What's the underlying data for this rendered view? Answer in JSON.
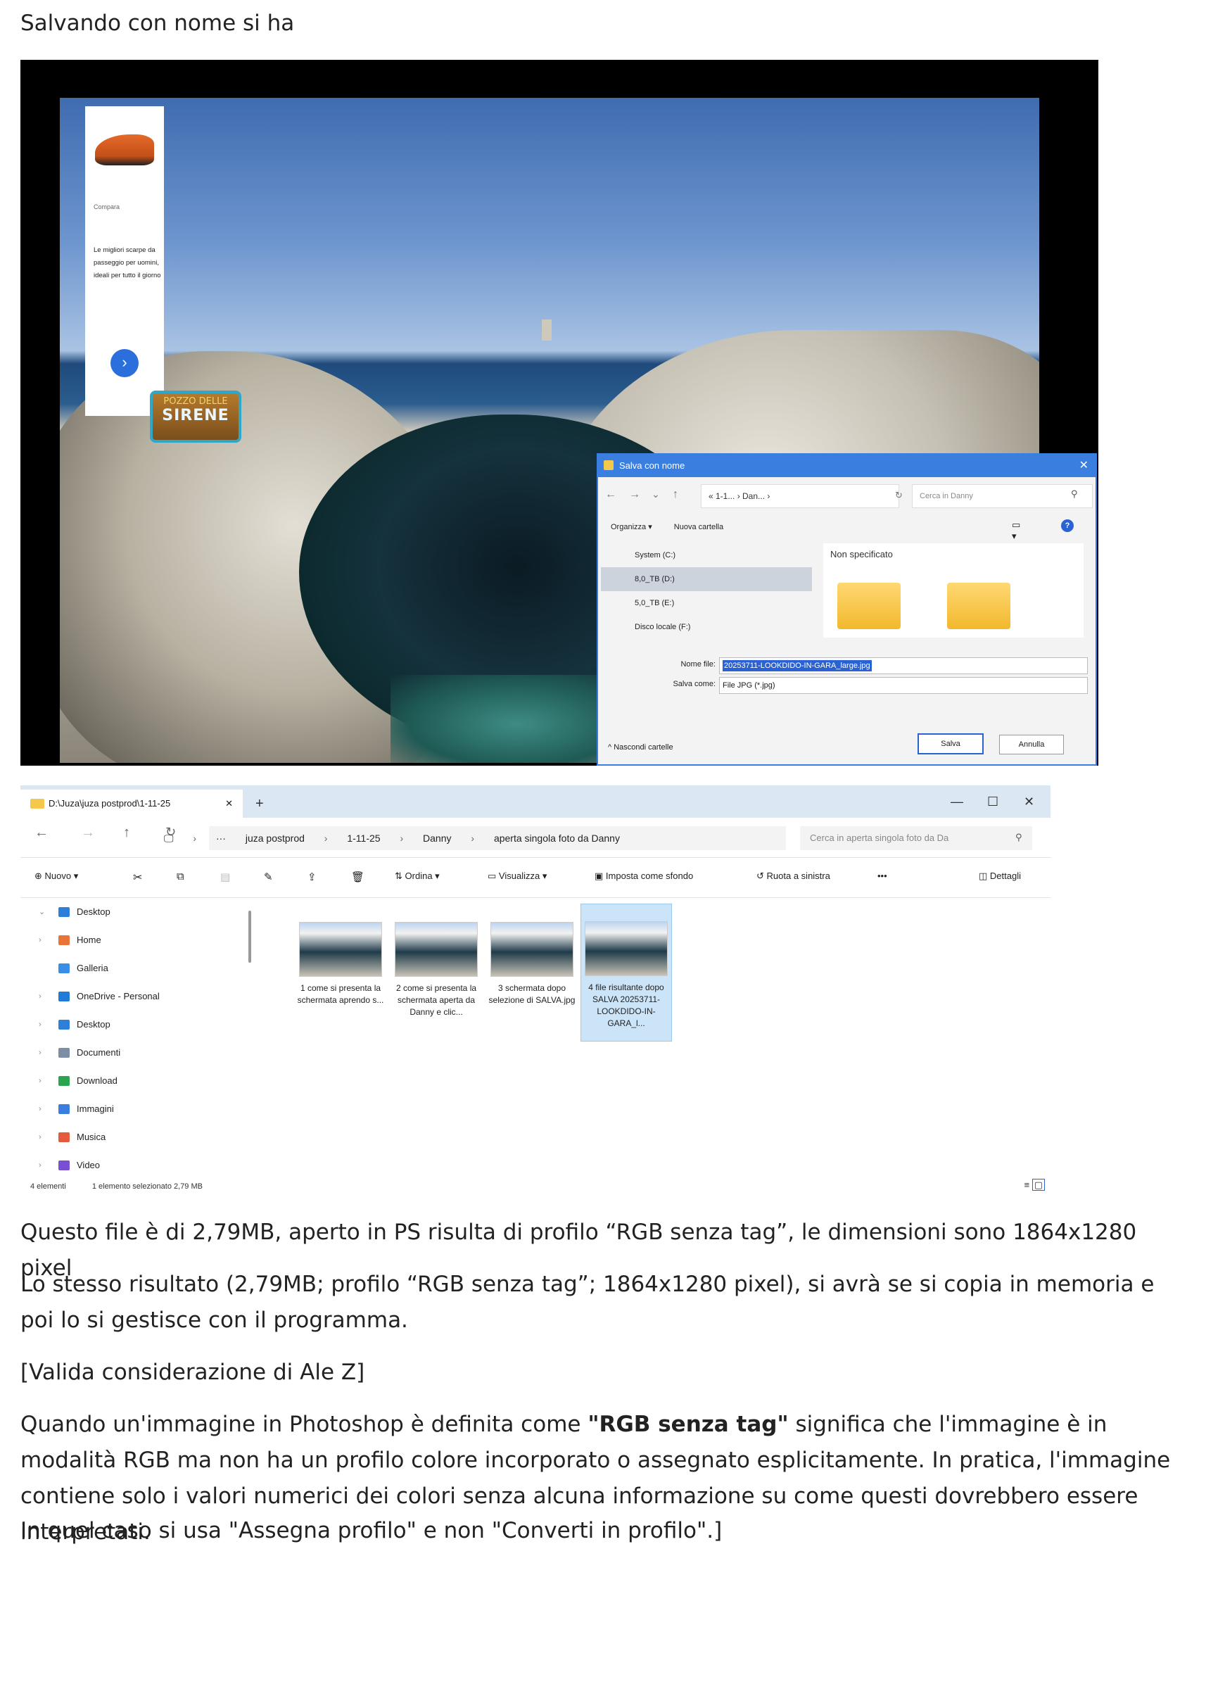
{
  "doc": {
    "intro": "Salvando con nome si ha",
    "p1": "Questo file è di 2,79MB, aperto in PS risulta di profilo “RGB senza tag”, le dimensioni sono 1864x1280 pixel",
    "p2": "Lo stesso risultato (2,79MB; profilo “RGB senza tag”; 1864x1280 pixel), si avrà se si copia in memoria e poi lo si gestisce con il programma.",
    "p3": "[Valida considerazione di Ale Z]",
    "p4_pre": "Quando un'immagine in Photoshop è definita come ",
    "p4_bold": "\"RGB senza tag\"",
    "p4_post": " significa che l'immagine è in modalità RGB ma non ha un profilo colore incorporato o assegnato esplicitamente. In pratica, l'immagine contiene solo i valori numerici dei colori senza alcuna informazione su come questi dovrebbero essere interpretati.",
    "p5": "In quel caso si usa \"Assegna profilo\" e non \"Converti in profilo\".]"
  },
  "ad": {
    "small_label": "Compara",
    "description": "Le migliori scarpe da passeggio per uomini, ideali per tutto il giorno",
    "next_glyph": "›"
  },
  "sign": {
    "line1": "POZZO DELLE",
    "line2": "SIRENE"
  },
  "save_dialog": {
    "title": "Salva con nome",
    "address": "« 1-1... › Dan... ›",
    "search_placeholder": "Cerca in Danny",
    "organize": "Organizza ▾",
    "new_folder": "Nuova cartella",
    "tree": [
      "System (C:)",
      "8,0_TB (D:)",
      "5,0_TB (E:)",
      "Disco locale (F:)"
    ],
    "group": "Non specificato",
    "filename_label": "Nome file:",
    "filename_value": "20253711-LOOKDIDO-IN-GARA_large.jpg",
    "type_label": "Salva come:",
    "type_value": "File JPG (*.jpg)",
    "hide_folders": "Nascondi cartelle",
    "save_btn": "Salva",
    "cancel_btn": "Annulla"
  },
  "explorer": {
    "tab_title": "D:\\Juza\\juza postprod\\1-11-25",
    "breadcrumbs": [
      "juza postprod",
      "1-11-25",
      "Danny",
      "aperta singola foto da Danny"
    ],
    "search_placeholder": "Cerca in aperta singola foto da Da",
    "commands": {
      "new": "Nuovo",
      "sort": "Ordina",
      "view": "Visualizza",
      "set_background": "Imposta come sfondo",
      "rotate_left": "Ruota a sinistra",
      "more": "•••",
      "details": "Dettagli"
    },
    "sidebar": [
      {
        "label": "Desktop",
        "color": "#2f7fd8",
        "chev": "⌄"
      },
      {
        "label": "Home",
        "color": "#e9743a",
        "chev": "›"
      },
      {
        "label": "Galleria",
        "color": "#3a8ee6",
        "chev": ""
      },
      {
        "label": "OneDrive - Personal",
        "color": "#1f7ad8",
        "chev": "›"
      },
      {
        "label": "Desktop",
        "color": "#2f7fd8",
        "chev": "›"
      },
      {
        "label": "Documenti",
        "color": "#7c8ea4",
        "chev": "›"
      },
      {
        "label": "Download",
        "color": "#2aa44f",
        "chev": "›"
      },
      {
        "label": "Immagini",
        "color": "#3a7ee0",
        "chev": "›"
      },
      {
        "label": "Musica",
        "color": "#e35a3c",
        "chev": "›"
      },
      {
        "label": "Video",
        "color": "#7b4fd1",
        "chev": "›"
      }
    ],
    "files": [
      {
        "name": "1 come si presenta la schermata aprendo s..."
      },
      {
        "name": "2 come si presenta la schermata aperta da Danny e clic..."
      },
      {
        "name": "3 schermata dopo selezione di SALVA.jpg"
      },
      {
        "name": "4 file risultante dopo SALVA 20253711-LOOKDIDO-IN-GARA_l..."
      }
    ],
    "status": {
      "count": "4 elementi",
      "selection": "1 elemento selezionato  2,79 MB"
    }
  }
}
